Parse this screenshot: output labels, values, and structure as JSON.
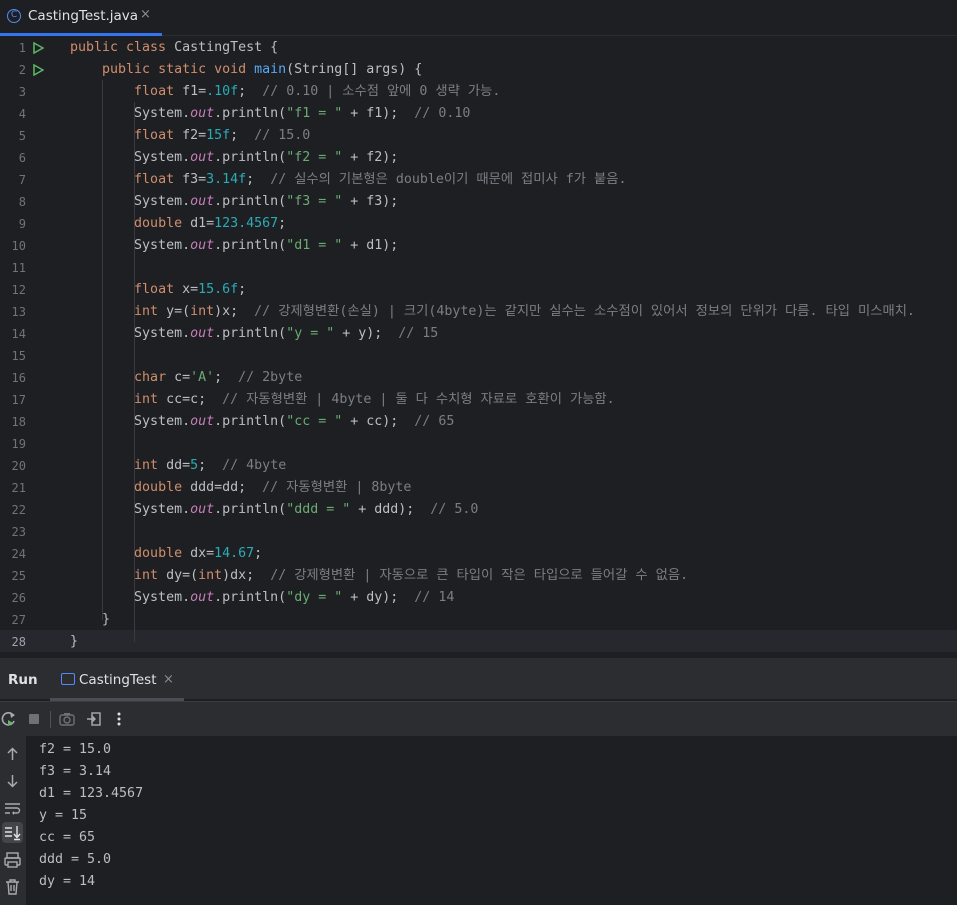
{
  "editor_tab": {
    "name": "CastingTest.java",
    "icon": "java-class-icon",
    "close": "×"
  },
  "code_lines": [
    {
      "n": "1",
      "s": [
        [
          "kw",
          "public class "
        ],
        [
          "",
          "CastingTest {"
        ]
      ]
    },
    {
      "n": "2",
      "s": [
        [
          "",
          "    "
        ],
        [
          "kw",
          "public static void "
        ],
        [
          "fn",
          "main"
        ],
        [
          "",
          "(String[] args) {"
        ]
      ]
    },
    {
      "n": "3",
      "s": [
        [
          "",
          "        "
        ],
        [
          "kw",
          "float "
        ],
        [
          "",
          "f1="
        ],
        [
          "num",
          ".10f"
        ],
        [
          "",
          ";  "
        ],
        [
          "cm",
          "// 0.10 | 소수점 앞에 0 생략 가능."
        ]
      ]
    },
    {
      "n": "4",
      "s": [
        [
          "",
          "        System."
        ],
        [
          "st",
          "out"
        ],
        [
          "",
          ".println("
        ],
        [
          "str",
          "\"f1 = \""
        ],
        [
          "",
          " + f1);  "
        ],
        [
          "cm",
          "// 0.10"
        ]
      ]
    },
    {
      "n": "5",
      "s": [
        [
          "",
          "        "
        ],
        [
          "kw",
          "float "
        ],
        [
          "",
          "f2="
        ],
        [
          "num",
          "15f"
        ],
        [
          "",
          ";  "
        ],
        [
          "cm",
          "// 15.0"
        ]
      ]
    },
    {
      "n": "6",
      "s": [
        [
          "",
          "        System."
        ],
        [
          "st",
          "out"
        ],
        [
          "",
          ".println("
        ],
        [
          "str",
          "\"f2 = \""
        ],
        [
          "",
          " + f2);"
        ]
      ]
    },
    {
      "n": "7",
      "s": [
        [
          "",
          "        "
        ],
        [
          "kw",
          "float "
        ],
        [
          "",
          "f3="
        ],
        [
          "num",
          "3.14f"
        ],
        [
          "",
          ";  "
        ],
        [
          "cm",
          "// 실수의 기본형은 double이기 때문에 접미사 f가 붙음."
        ]
      ]
    },
    {
      "n": "8",
      "s": [
        [
          "",
          "        System."
        ],
        [
          "st",
          "out"
        ],
        [
          "",
          ".println("
        ],
        [
          "str",
          "\"f3 = \""
        ],
        [
          "",
          " + f3);"
        ]
      ]
    },
    {
      "n": "9",
      "s": [
        [
          "",
          "        "
        ],
        [
          "kw",
          "double "
        ],
        [
          "",
          "d1="
        ],
        [
          "num",
          "123.4567"
        ],
        [
          "",
          ";"
        ]
      ]
    },
    {
      "n": "10",
      "s": [
        [
          "",
          "        System."
        ],
        [
          "st",
          "out"
        ],
        [
          "",
          ".println("
        ],
        [
          "str",
          "\"d1 = \""
        ],
        [
          "",
          " + d1);"
        ]
      ]
    },
    {
      "n": "11",
      "s": []
    },
    {
      "n": "12",
      "s": [
        [
          "",
          "        "
        ],
        [
          "kw",
          "float "
        ],
        [
          "",
          "x="
        ],
        [
          "num",
          "15.6f"
        ],
        [
          "",
          ";"
        ]
      ]
    },
    {
      "n": "13",
      "s": [
        [
          "",
          "        "
        ],
        [
          "kw",
          "int "
        ],
        [
          "",
          "y=("
        ],
        [
          "kw",
          "int"
        ],
        [
          "",
          ")x;  "
        ],
        [
          "cm",
          "// 강제형변환(손실) | 크기(4byte)는 같지만 실수는 소수점이 있어서 정보의 단위가 다름. 타입 미스매치."
        ]
      ]
    },
    {
      "n": "14",
      "s": [
        [
          "",
          "        System."
        ],
        [
          "st",
          "out"
        ],
        [
          "",
          ".println("
        ],
        [
          "str",
          "\"y = \""
        ],
        [
          "",
          " + y);  "
        ],
        [
          "cm",
          "// 15"
        ]
      ]
    },
    {
      "n": "15",
      "s": []
    },
    {
      "n": "16",
      "s": [
        [
          "",
          "        "
        ],
        [
          "kw",
          "char "
        ],
        [
          "",
          "c="
        ],
        [
          "str",
          "'A'"
        ],
        [
          "",
          ";  "
        ],
        [
          "cm",
          "// 2byte"
        ]
      ]
    },
    {
      "n": "17",
      "s": [
        [
          "",
          "        "
        ],
        [
          "kw",
          "int "
        ],
        [
          "",
          "cc=c;  "
        ],
        [
          "cm",
          "// 자동형변환 | 4byte | 둘 다 수치형 자료로 호환이 가능함."
        ]
      ]
    },
    {
      "n": "18",
      "s": [
        [
          "",
          "        System."
        ],
        [
          "st",
          "out"
        ],
        [
          "",
          ".println("
        ],
        [
          "str",
          "\"cc = \""
        ],
        [
          "",
          " + cc);  "
        ],
        [
          "cm",
          "// 65"
        ]
      ]
    },
    {
      "n": "19",
      "s": []
    },
    {
      "n": "20",
      "s": [
        [
          "",
          "        "
        ],
        [
          "kw",
          "int "
        ],
        [
          "",
          "dd="
        ],
        [
          "num",
          "5"
        ],
        [
          "",
          ";  "
        ],
        [
          "cm",
          "// 4byte"
        ]
      ]
    },
    {
      "n": "21",
      "s": [
        [
          "",
          "        "
        ],
        [
          "kw",
          "double "
        ],
        [
          "",
          "ddd=dd;  "
        ],
        [
          "cm",
          "// 자동형변환 | 8byte"
        ]
      ]
    },
    {
      "n": "22",
      "s": [
        [
          "",
          "        System."
        ],
        [
          "st",
          "out"
        ],
        [
          "",
          ".println("
        ],
        [
          "str",
          "\"ddd = \""
        ],
        [
          "",
          " + ddd);  "
        ],
        [
          "cm",
          "// 5.0"
        ]
      ]
    },
    {
      "n": "23",
      "s": []
    },
    {
      "n": "24",
      "s": [
        [
          "",
          "        "
        ],
        [
          "kw",
          "double "
        ],
        [
          "",
          "dx="
        ],
        [
          "num",
          "14.67"
        ],
        [
          "",
          ";"
        ]
      ]
    },
    {
      "n": "25",
      "s": [
        [
          "",
          "        "
        ],
        [
          "kw",
          "int "
        ],
        [
          "",
          "dy=("
        ],
        [
          "kw",
          "int"
        ],
        [
          "",
          ")dx;  "
        ],
        [
          "cm",
          "// 강제형변환 | 자동으로 큰 타입이 작은 타입으로 들어갈 수 없음."
        ]
      ]
    },
    {
      "n": "26",
      "s": [
        [
          "",
          "        System."
        ],
        [
          "st",
          "out"
        ],
        [
          "",
          ".println("
        ],
        [
          "str",
          "\"dy = \""
        ],
        [
          "",
          " + dy);  "
        ],
        [
          "cm",
          "// 14"
        ]
      ]
    },
    {
      "n": "27",
      "s": [
        [
          "",
          "    }"
        ]
      ]
    },
    {
      "n": "28",
      "s": [
        [
          "",
          "}"
        ]
      ]
    }
  ],
  "run_panel": {
    "title": "Run",
    "tab_name": "CastingTest",
    "close": "×"
  },
  "run_toolbar": [
    "rerun-icon",
    "stop-icon",
    "camera-icon",
    "exit-icon",
    "more-icon"
  ],
  "console_output": [
    "f2 = 15.0",
    "f3 = 3.14",
    "d1 = 123.4567",
    "y = 15",
    "cc = 65",
    "ddd = 5.0",
    "dy = 14"
  ],
  "colors": {
    "keyword": "#cf8e6d",
    "number": "#2aacb8",
    "string": "#6aab73",
    "comment": "#7a7e85",
    "static_field": "#c77dbb",
    "method": "#56a8f5",
    "accent": "#3574f0",
    "run_icon": "#5fb865"
  }
}
